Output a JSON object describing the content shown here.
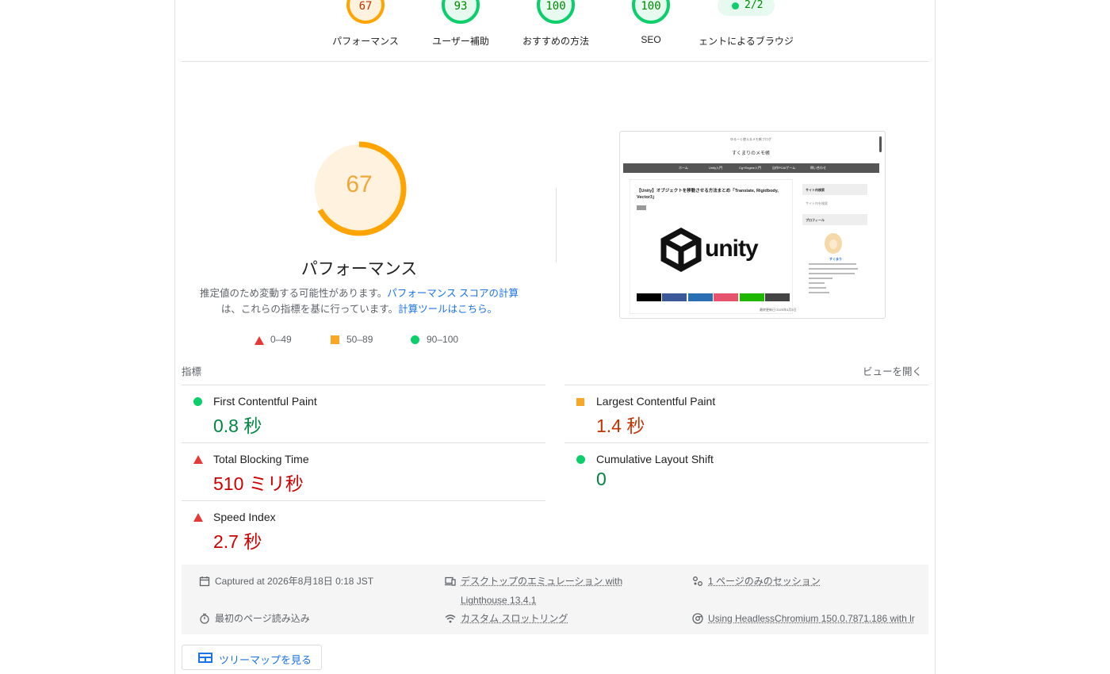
{
  "top_gauges": [
    {
      "score": "67",
      "label": "パフォーマンス",
      "status": "average"
    },
    {
      "score": "93",
      "label": "ユーザー補助",
      "status": "pass"
    },
    {
      "score": "100",
      "label": "おすすめの方法",
      "status": "pass"
    },
    {
      "score": "100",
      "label": "SEO",
      "status": "pass"
    },
    {
      "score": "2/2",
      "label": "ェントによるブラウジ",
      "status": "pass"
    }
  ],
  "performance": {
    "score": "67",
    "score_fraction": 0.67,
    "title": "パフォーマンス",
    "desc_text1": "推定値のため変動する可能性があります。",
    "desc_link1": "パフォーマンス スコアの計算",
    "desc_text2": "は、これらの指標を基に行っています。",
    "desc_link2": "計算ツールはこちら。"
  },
  "legend": {
    "fail": "0–49",
    "average": "50–89",
    "pass": "90–100"
  },
  "thumbnail": {
    "site_tagline": "ゆるーく使えるメモ帳ブログ",
    "site_title": "すくまりのメモ帳",
    "nav": [
      "ホーム",
      "Unity入門",
      "Cg+Engine入門",
      "自作PCAIゲーム",
      "問い合わせ"
    ],
    "article_title": "【Unity】オブジェクトを移動させる方法まとめ「Translate, Rigidbody, Vector3」",
    "logo_word": "unity",
    "sidebar_search": "サイト内検索",
    "sidebar_search_placeholder": "サイト内を検索",
    "sidebar_profile": "プロフィール",
    "profile_name": "すくまり",
    "footer": "最終更新日 2025年3月3日",
    "share_colors": [
      "#000000",
      "#3b5998",
      "#2a6fb3",
      "#e5546c",
      "#1fb800",
      "#444444"
    ]
  },
  "metrics": {
    "header": "指標",
    "expand_view": "ビューを開く",
    "items": [
      {
        "name": "First Contentful Paint",
        "value": "0.8 秒",
        "status": "pass"
      },
      {
        "name": "Largest Contentful Paint",
        "value": "1.4 秒",
        "status": "average"
      },
      {
        "name": "Total Blocking Time",
        "value": "510 ミリ秒",
        "status": "fail"
      },
      {
        "name": "Cumulative Layout Shift",
        "value": "0",
        "status": "pass"
      },
      {
        "name": "Speed Index",
        "value": "2.7 秒",
        "status": "fail"
      }
    ]
  },
  "runtime": {
    "captured": "Captured at 2026年8月18日 0:18 JST",
    "emulation_line1": "デスクトップのエミュレーション with",
    "emulation_line2": "Lighthouse 13.4.1",
    "session": "1 ページのみのセッション",
    "initial_load": "最初のページ読み込み",
    "throttling": "カスタム スロットリング",
    "browser": "Using HeadlessChromium 150.0.7871.186 with lr"
  },
  "treemap_button": "ツリーマップを見る",
  "colors": {
    "pass": "#0cce6b",
    "average": "#ffa400",
    "fail": "#e53935",
    "link": "#1a73e8"
  }
}
